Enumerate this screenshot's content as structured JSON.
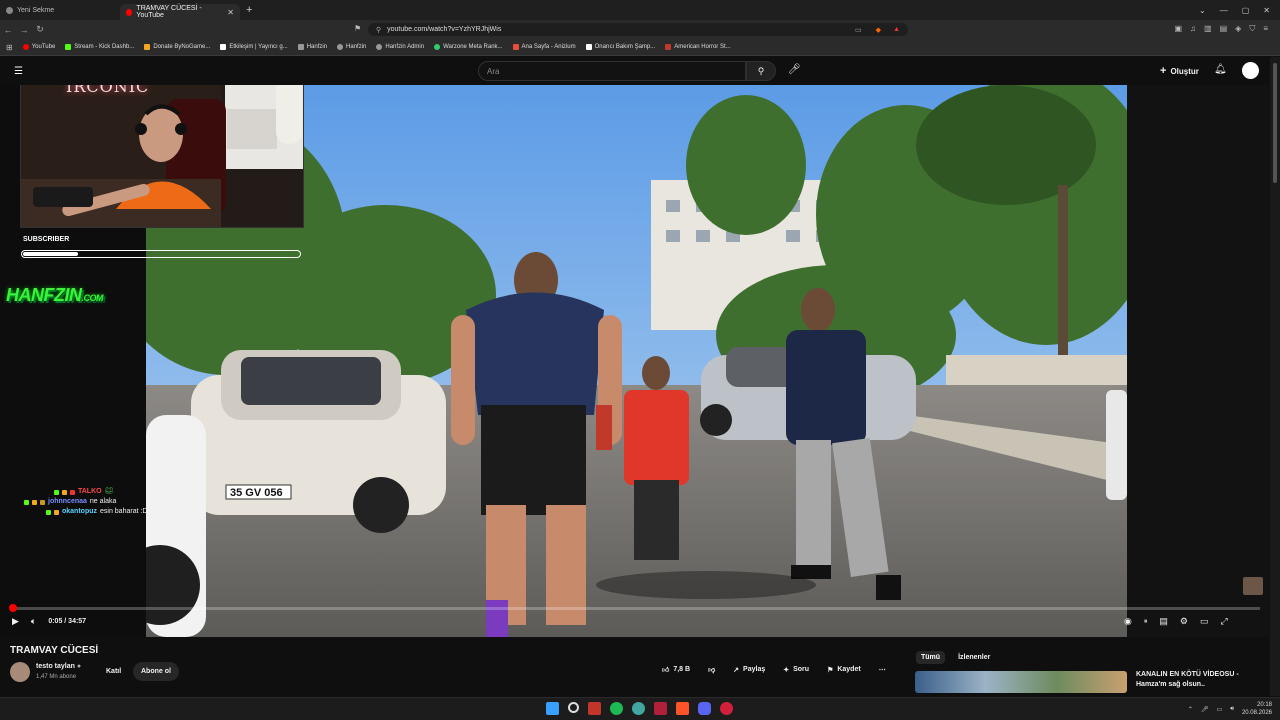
{
  "browser": {
    "tabs": [
      {
        "label": "Yeni Sekme",
        "active": false
      },
      {
        "label": "TRAMVAY CÜCESİ - YouTube",
        "active": true
      }
    ],
    "url": "youtube.com/watch?v=YzhYRJhjWis",
    "bookmarks": [
      {
        "label": "YouTube",
        "color": "#ff0000"
      },
      {
        "label": "Stream - Kick Dashb...",
        "color": "#53fc18"
      },
      {
        "label": "Donate ByNoGame...",
        "color": "#f5a623"
      },
      {
        "label": "Etkileşim | Yayıncı g...",
        "color": "#ffffff"
      },
      {
        "label": "Hanfzin",
        "color": "#999999"
      },
      {
        "label": "Hanfzin",
        "color": "#999999"
      },
      {
        "label": "Hanfzin Admin",
        "color": "#999999"
      },
      {
        "label": "Warzone Meta Rank...",
        "color": "#2ecc71"
      },
      {
        "label": "Ana Sayfa - Anizium",
        "color": "#e74c3c"
      },
      {
        "label": "Onarıcı Bakım Şamp...",
        "color": "#ffffff"
      },
      {
        "label": "American Horror St...",
        "color": "#c0392b"
      }
    ]
  },
  "youtube": {
    "search_placeholder": "Ara",
    "create_label": "Oluştur"
  },
  "overlay": {
    "webcam_sign": "IRCONIC",
    "subscriber_label": "SUBSCRIBER",
    "subscriber_progress": 0.2,
    "logo_text": "HANFZIN",
    "logo_suffix": ".COM",
    "chat": [
      {
        "user": "TALKO",
        "message": ""
      },
      {
        "user": "johnncenaa",
        "message": "ne alaka"
      },
      {
        "user": "okantopuz",
        "message": "esin baharat :D"
      }
    ]
  },
  "player": {
    "current_time": "0:05",
    "duration": "34:57",
    "timecode": "0:05 / 34:57",
    "progress_fraction": 0.0024
  },
  "video_info": {
    "title": "TRAMVAY CÜCESİ",
    "channel": "testo taylan",
    "subscribers": "1,47 Mn abone",
    "join_label": "Katıl",
    "subscribe_label": "Abone ol",
    "likes": "7,8 B",
    "share_label": "Paylaş",
    "ask_label": "Soru",
    "save_label": "Kaydet"
  },
  "recommendations": {
    "chips": [
      "Tümü",
      "İzlenenler"
    ],
    "first_title": "KANALIN EN KÖTÜ VİDEOSU - Hamza'm sağ olsun.."
  },
  "taskbar": {
    "time": "20:18",
    "date": "20.08.2026"
  }
}
